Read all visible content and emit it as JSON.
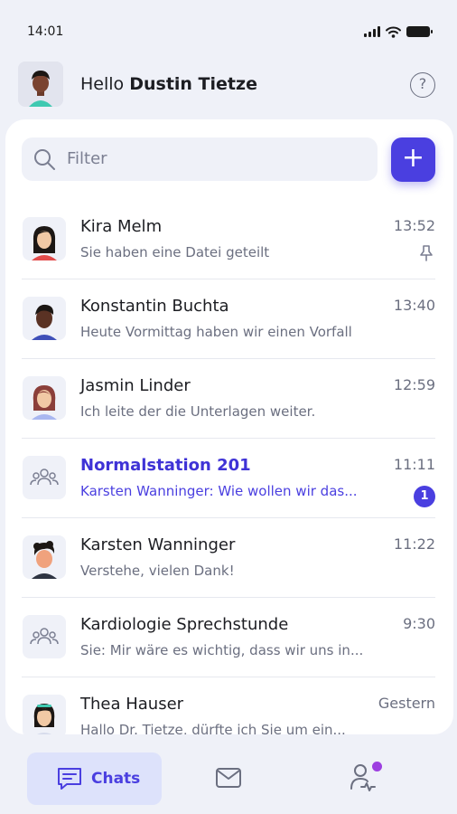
{
  "status_bar": {
    "time": "14:01"
  },
  "header": {
    "greeting_prefix": "Hello",
    "user_name": "Dustin Tietze",
    "help_label": "?"
  },
  "search": {
    "placeholder": "Filter",
    "add_label": "+"
  },
  "chats": [
    {
      "name": "Kira Melm",
      "preview": "Sie haben eine Datei geteilt",
      "time": "13:52",
      "pinned": true,
      "avatar": "woman-dark-hair"
    },
    {
      "name": "Konstantin Buchta",
      "preview": "Heute Vormittag haben wir einen Vorfall",
      "time": "13:40",
      "avatar": "man-dark-skin"
    },
    {
      "name": "Jasmin Linder",
      "preview": "Ich leite der die Unterlagen weiter.",
      "time": "12:59",
      "avatar": "woman-brown-hair"
    },
    {
      "name": "Normalstation 201",
      "preview": "Karsten Wanninger: Wie wollen wir das...",
      "time": "11:11",
      "unread": "1",
      "avatar": "group-icon"
    },
    {
      "name": "Karsten Wanninger",
      "preview": "Verstehe, vielen Dank!",
      "time": "11:22",
      "avatar": "man-curly-hair"
    },
    {
      "name": "Kardiologie Sprechstunde",
      "preview": "Sie: Mir wäre es wichtig, dass wir uns in...",
      "time": "9:30",
      "avatar": "group-icon"
    },
    {
      "name": "Thea Hauser",
      "preview": "Hallo Dr. Tietze, dürfte ich Sie um ein...",
      "time": "Gestern",
      "avatar": "woman-black-hair"
    }
  ],
  "nav": {
    "chats_label": "Chats"
  },
  "colors": {
    "accent": "#4a3fe0",
    "background": "#eff1f8",
    "nav_active_bg": "#dde2fb",
    "notification_dot": "#9d3fe0"
  }
}
